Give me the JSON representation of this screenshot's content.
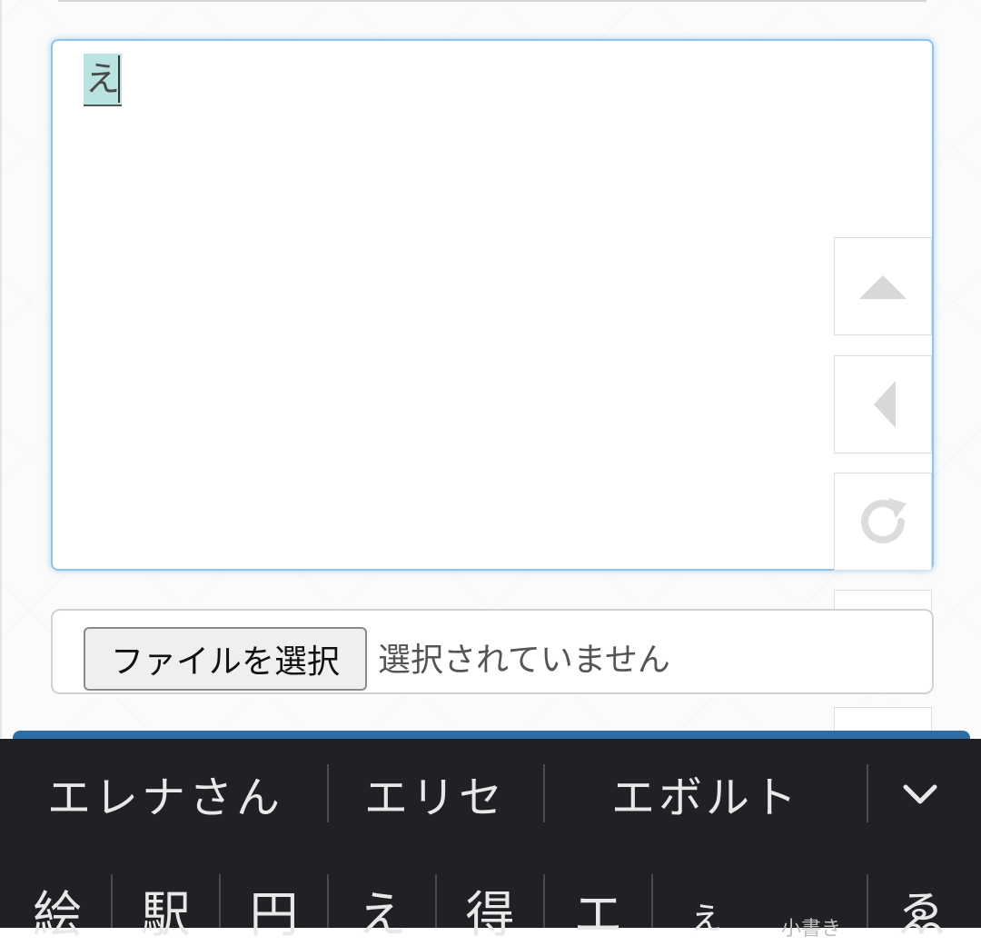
{
  "editor": {
    "typed_text": "え"
  },
  "file_input": {
    "button_label": "ファイルを選択",
    "status": "選択されていません"
  },
  "side_buttons": [
    {
      "icon": "triangle-up-icon"
    },
    {
      "icon": "triangle-left-icon"
    },
    {
      "icon": "refresh-icon"
    },
    {
      "icon": "edit-icon"
    }
  ],
  "ime": {
    "suggestions": [
      "エレナさん",
      "エリセ",
      "エボルト"
    ],
    "expand_icon": "chevron-down-icon",
    "candidates": [
      "絵",
      "駅",
      "円",
      "え",
      "得",
      "エ",
      "ぇ",
      "ゑ"
    ],
    "small_kana_label": "小書き"
  },
  "colors": {
    "focus_border": "#8fc4e6",
    "selection_highlight": "#b8e3e0",
    "keyboard_bg": "#202124",
    "accent_bar": "#2f6ea5"
  }
}
